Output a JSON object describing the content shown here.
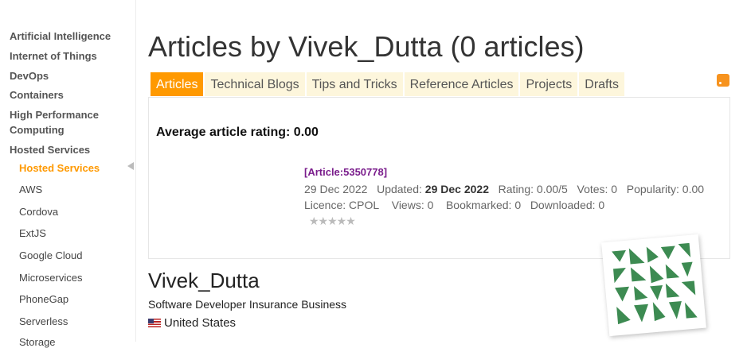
{
  "sidebar": {
    "groups": [
      "Artificial Intelligence",
      "Internet of Things",
      "DevOps",
      "Containers",
      "High Performance Computing",
      "Hosted Services"
    ],
    "items": [
      "Hosted Services",
      "AWS",
      "Cordova",
      "ExtJS",
      "Google Cloud",
      "Microservices",
      "PhoneGap",
      "Serverless",
      "Storage"
    ],
    "active_item": "Hosted Services"
  },
  "page": {
    "title": "Articles by Vivek_Dutta (0 articles)",
    "tabs": [
      "Articles",
      "Technical Blogs",
      "Tips and Tricks",
      "Reference Articles",
      "Projects",
      "Drafts"
    ],
    "active_tab": "Articles",
    "rss_icon": "rss-icon"
  },
  "summary": {
    "average_rating": "Average article rating: 0.00"
  },
  "article": {
    "link": "[Article:5350778]",
    "date": "29 Dec 2022",
    "updated_label": "Updated:",
    "updated": "29 Dec 2022",
    "rating": "Rating: 0.00/5",
    "votes": "Votes: 0",
    "popularity": "Popularity: 0.00",
    "licence": "Licence: CPOL",
    "views": "Views: 0",
    "bookmarked": "Bookmarked: 0",
    "downloaded": "Downloaded: 0",
    "stars": "★★★★★",
    "star_rating": 0
  },
  "profile": {
    "name": "Vivek_Dutta",
    "job": "Software Developer Insurance Business",
    "country": "United States",
    "avatar_color": "#3d8b52"
  }
}
